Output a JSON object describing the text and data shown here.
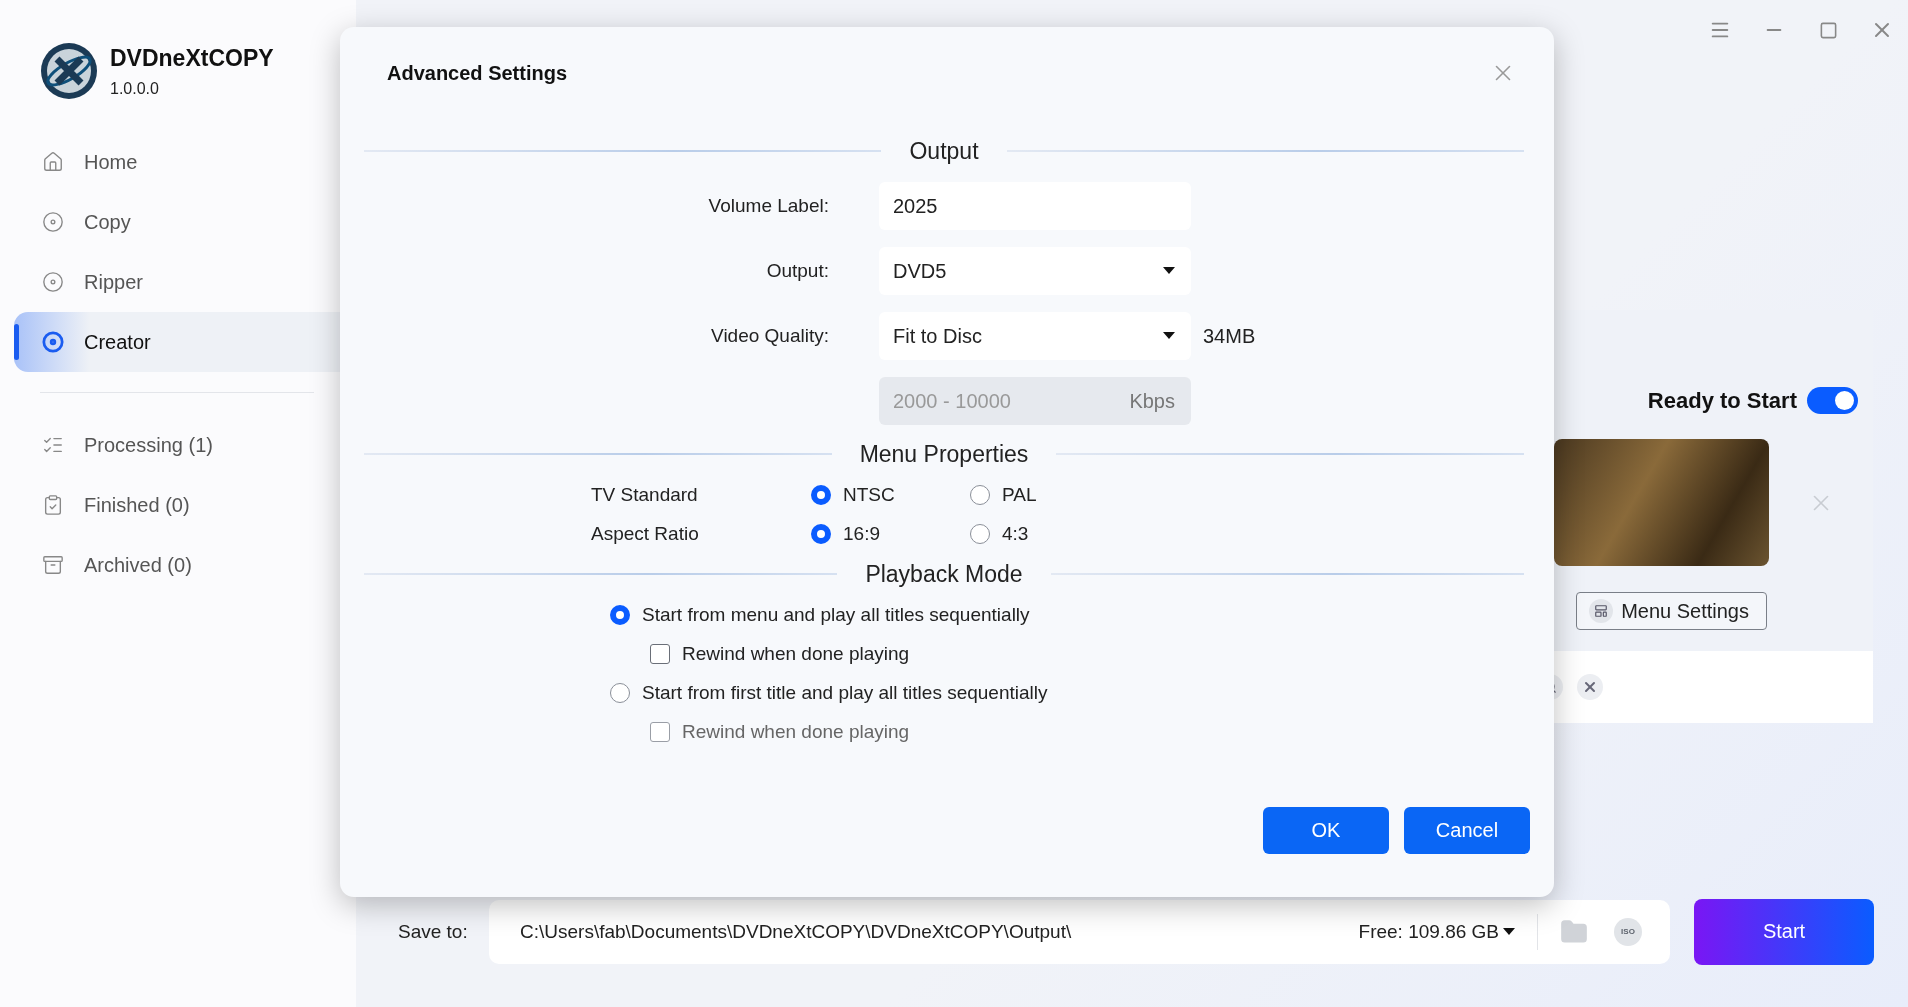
{
  "app": {
    "name": "DVDneXtCOPY",
    "version": "1.0.0.0"
  },
  "sidebar": {
    "nav": [
      {
        "label": "Home",
        "selected": false
      },
      {
        "label": "Copy",
        "selected": false
      },
      {
        "label": "Ripper",
        "selected": false
      },
      {
        "label": "Creator",
        "selected": true
      }
    ],
    "queues": [
      {
        "label": "Processing (1)"
      },
      {
        "label": "Finished (0)"
      },
      {
        "label": "Archived (0)"
      }
    ]
  },
  "panel": {
    "status_label": "Ready to Start",
    "ready": true,
    "menu_settings_button": "Menu Settings"
  },
  "dialog": {
    "title": "Advanced Settings",
    "output": {
      "heading": "Output",
      "fields": [
        {
          "kind": "text",
          "label": "Volume Label:",
          "value": "2025"
        },
        {
          "kind": "select",
          "label": "Output:",
          "value": "DVD5"
        },
        {
          "kind": "select",
          "label": "Video Quality:",
          "value": "Fit to Disc",
          "note": "34MB"
        },
        {
          "kind": "range",
          "placeholder": "2000 - 10000",
          "unit": "Kbps",
          "disabled": true
        }
      ]
    },
    "menu_properties": {
      "heading": "Menu Properties",
      "rows": [
        {
          "label": "TV Standard",
          "options": [
            {
              "label": "NTSC",
              "selected": true
            },
            {
              "label": "PAL",
              "selected": false
            }
          ]
        },
        {
          "label": "Aspect Ratio",
          "options": [
            {
              "label": "16:9",
              "selected": true
            },
            {
              "label": "4:3",
              "selected": false
            }
          ]
        }
      ]
    },
    "playback": {
      "heading": "Playback Mode",
      "options": [
        {
          "label": "Start from menu and play all titles sequentially",
          "selected": true,
          "rewind": {
            "label": "Rewind when done playing",
            "checked": false,
            "disabled": false
          }
        },
        {
          "label": "Start from first title and play all titles sequentially",
          "selected": false,
          "rewind": {
            "label": "Rewind when done playing",
            "checked": false,
            "disabled": true
          }
        }
      ]
    },
    "buttons": [
      {
        "label": "OK"
      },
      {
        "label": "Cancel"
      }
    ]
  },
  "save_bar": {
    "label": "Save to:",
    "path": "C:\\Users\\fab\\Documents\\DVDneXtCOPY\\DVDneXtCOPY\\Output\\",
    "free": "Free: 109.86 GB",
    "iso": "ISO",
    "start": "Start"
  }
}
